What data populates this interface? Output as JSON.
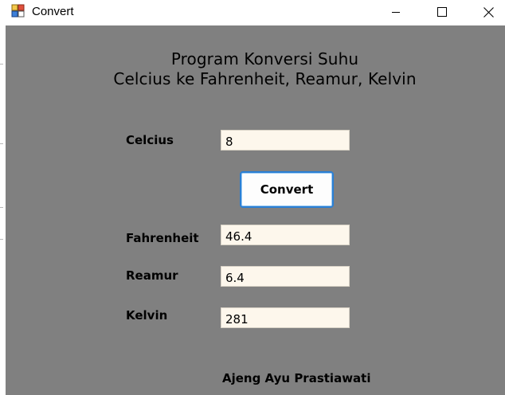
{
  "window": {
    "title": "Convert"
  },
  "heading": {
    "line1": "Program Konversi Suhu",
    "line2": "Celcius ke Fahrenheit, Reamur, Kelvin"
  },
  "form": {
    "celcius_label": "Celcius",
    "celcius_value": "8",
    "convert_label": "Convert",
    "fahrenheit_label": "Fahrenheit",
    "fahrenheit_value": "46.4",
    "reamur_label": "Reamur",
    "reamur_value": "6.4",
    "kelvin_label": "Kelvin",
    "kelvin_value": "281"
  },
  "footer": {
    "author": "Ajeng Ayu Prastiawati"
  },
  "colors": {
    "client_background": "#808080",
    "field_background": "#fdf7ec",
    "button_border": "#2a7fd4"
  },
  "icons": [
    "app-icon",
    "minimize-icon",
    "maximize-icon",
    "close-icon"
  ]
}
